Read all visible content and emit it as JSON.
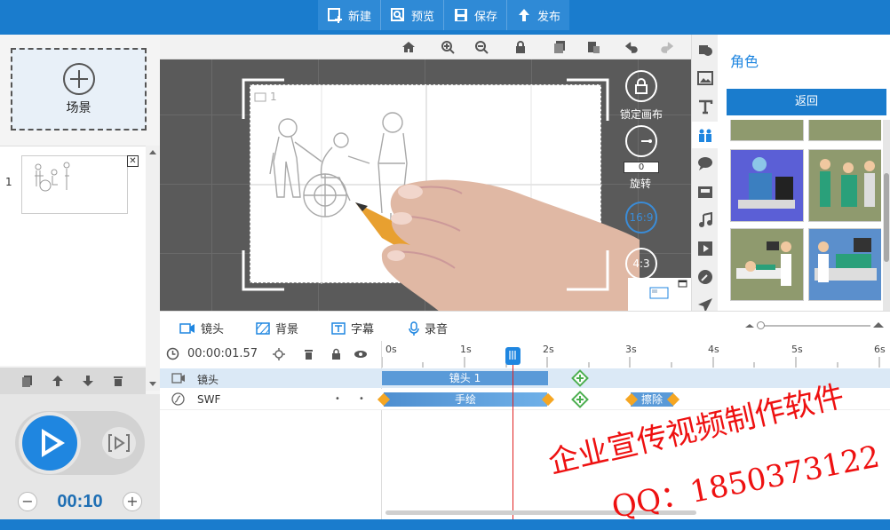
{
  "toolbar": {
    "new_label": "新建",
    "preview_label": "预览",
    "save_label": "保存",
    "publish_label": "发布"
  },
  "scenes": {
    "add_label": "场景",
    "items": [
      {
        "index": "1"
      }
    ]
  },
  "player": {
    "duration": "00:10",
    "minus": "−",
    "plus": "+"
  },
  "canvas": {
    "slide_number": "1",
    "lock_label": "锁定画布",
    "rotate_value": "0",
    "rotate_label": "旋转",
    "ratio_169": "16:9",
    "ratio_43": "4:3"
  },
  "assets": {
    "title": "角色",
    "back_label": "返回"
  },
  "timeline": {
    "tabs": {
      "shot": "镜头",
      "background": "背景",
      "caption": "字幕",
      "record": "录音"
    },
    "current_time": "00:00:01.57",
    "ruler": [
      "0s",
      "1s",
      "2s",
      "3s",
      "4s",
      "5s",
      "6s"
    ],
    "tracks": [
      {
        "name": "镜头",
        "clip_label": "镜头 1"
      },
      {
        "name": "SWF",
        "clip_label": "手绘",
        "clip2_label": "擦除"
      }
    ]
  },
  "watermark": {
    "line1": "企业宣传视频制作软件",
    "line2": "QQ：1850373122"
  },
  "colors": {
    "accent": "#1a7ccd",
    "playhead": "#e02020",
    "watermark": "#e11111",
    "keyframe": "#f5a623",
    "add_key": "#4caf50"
  }
}
